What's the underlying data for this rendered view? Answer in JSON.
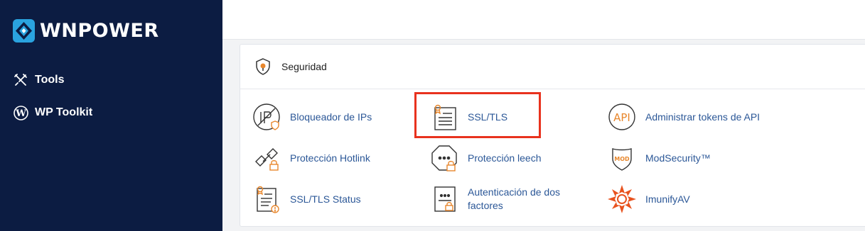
{
  "brand": {
    "name": "WNPOWER"
  },
  "sidebar": {
    "items": [
      {
        "label": "Tools",
        "icon": "tools-icon"
      },
      {
        "label": "WP Toolkit",
        "icon": "wordpress-icon"
      }
    ]
  },
  "section": {
    "title": "Seguridad",
    "icon": "security-shield-icon",
    "items": [
      {
        "label": "Bloqueador de IPs",
        "icon": "ip-blocker-icon"
      },
      {
        "label": "SSL/TLS",
        "icon": "ssl-certificate-icon"
      },
      {
        "label": "Administrar tokens de API",
        "icon": "api-icon"
      },
      {
        "label": "Protección Hotlink",
        "icon": "hotlink-protection-icon"
      },
      {
        "label": "Protección leech",
        "icon": "leech-protection-icon"
      },
      {
        "label": "ModSecurity™",
        "icon": "modsecurity-icon"
      },
      {
        "label": "SSL/TLS Status",
        "icon": "ssl-status-icon"
      },
      {
        "label": "Autenticación de dos factores",
        "label_line1": "Autenticación de dos",
        "label_line2": "factores",
        "icon": "two-factor-icon"
      },
      {
        "label": "ImunifyAV",
        "icon": "imunifyav-icon"
      }
    ]
  },
  "colors": {
    "sidebar": "#0c1c42",
    "link": "#2b5797",
    "accent": "#e8872d",
    "highlight": "#e8321e"
  }
}
